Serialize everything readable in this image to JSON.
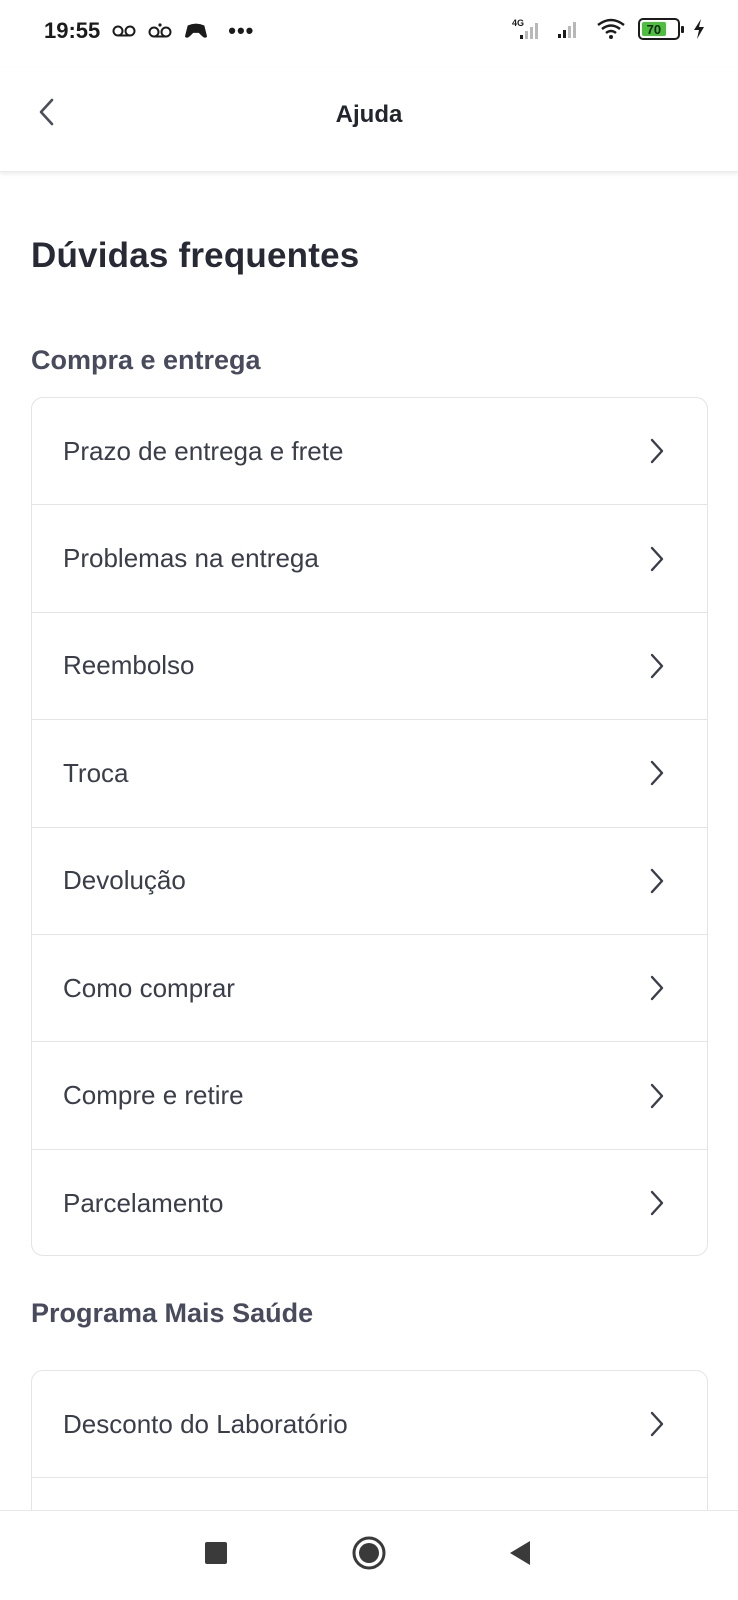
{
  "status_bar": {
    "time": "19:55",
    "left_icons": [
      "voicemail-icon",
      "voicemail-icon",
      "gamepad-icon"
    ],
    "more": "•••",
    "network": "4G",
    "battery_level": "70",
    "battery_color": "#49c23a"
  },
  "header": {
    "title": "Ajuda",
    "back_icon": "chevron-left-icon"
  },
  "page": {
    "title": "Dúvidas frequentes"
  },
  "sections": [
    {
      "title": "Compra e entrega",
      "items": [
        {
          "label": "Prazo de entrega e frete"
        },
        {
          "label": "Problemas na entrega"
        },
        {
          "label": "Reembolso"
        },
        {
          "label": "Troca"
        },
        {
          "label": "Devolução"
        },
        {
          "label": "Como comprar"
        },
        {
          "label": "Compre e retire"
        },
        {
          "label": "Parcelamento"
        }
      ]
    },
    {
      "title": "Programa Mais Saúde",
      "items": [
        {
          "label": "Desconto do Laboratório"
        },
        {
          "label": ""
        }
      ]
    }
  ],
  "nav": {
    "icons": [
      "square-icon",
      "circle-icon",
      "triangle-back-icon"
    ]
  }
}
